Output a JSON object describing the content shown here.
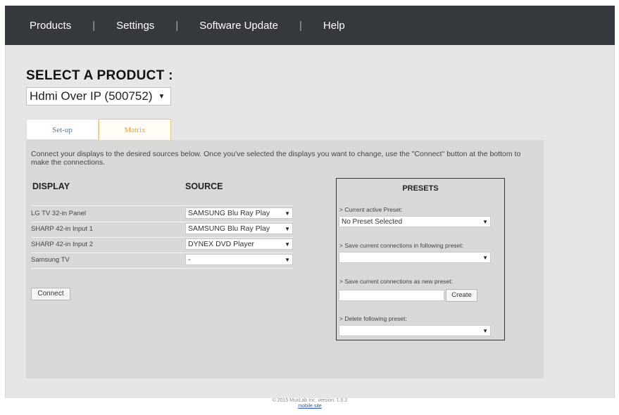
{
  "nav": {
    "items": [
      "Products",
      "Settings",
      "Software Update",
      "Help"
    ]
  },
  "product": {
    "heading": "SELECT A PRODUCT :",
    "selected": "Hdmi Over IP (500752)"
  },
  "tabs": [
    {
      "label": "Set-up",
      "active": false
    },
    {
      "label": "Matrix",
      "active": true
    }
  ],
  "matrix": {
    "intro": "Connect your displays to the desired sources below. Once you've selected the displays you want to change, use the \"Connect\" button at the bottom to make the connections.",
    "display_header": "DISPLAY",
    "source_header": "SOURCE",
    "rows": [
      {
        "display": "LG TV 32-in Panel",
        "source": "SAMSUNG Blu Ray Play"
      },
      {
        "display": "SHARP 42-in Input 1",
        "source": "SAMSUNG Blu Ray Play"
      },
      {
        "display": "SHARP 42-in Input 2",
        "source": "DYNEX DVD Player"
      },
      {
        "display": "Samsung TV",
        "source": "-"
      }
    ],
    "connect_label": "Connect"
  },
  "presets": {
    "title": "PRESETS",
    "current_label": "> Current active Preset:",
    "current_value": "No Preset Selected",
    "save_following_label": "> Save current connections in following preset:",
    "save_following_value": "",
    "save_new_label": "> Save current connections as new preset:",
    "new_preset_value": "",
    "create_label": "Create",
    "delete_label": "> Delete following preset:",
    "delete_value": ""
  },
  "footer": {
    "copyright": "© 2015 MuxLab Inc. version: 1.0.2",
    "mobile_link": "mobile site"
  },
  "colors": {
    "nav_bg": "#36393e",
    "matrix_tab": "#e9a23b",
    "setup_tab": "#4a7fa7"
  }
}
